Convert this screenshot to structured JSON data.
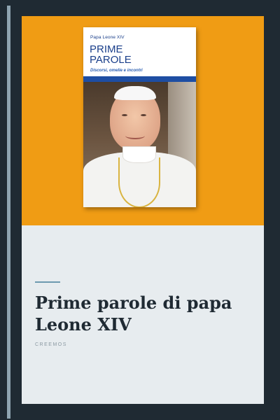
{
  "post": {
    "title": "Prime parole di papa Leone XIV",
    "category": "CREEMOS"
  },
  "book_cover": {
    "author": "Papa Leone XIV",
    "title": "PRIME\nPAROLE",
    "subtitle": "Discorsi, omelie e incontri"
  },
  "colors": {
    "page_background": "#1f2a33",
    "hero_background": "#f09c14",
    "card_background": "#e7ecef",
    "accent_divider": "#6d9aaf",
    "title_text": "#1f2a33",
    "book_blue": "#1a3f8a"
  }
}
